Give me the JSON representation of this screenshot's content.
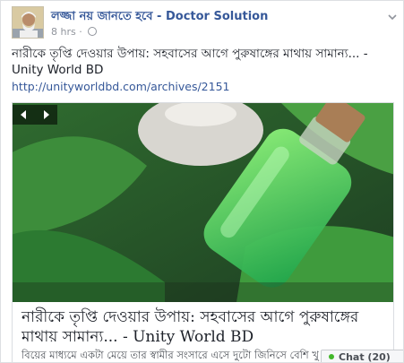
{
  "post": {
    "page_name": "লজ্জা নয় জানতে হবে - Doctor Solution",
    "time": "8 hrs",
    "text": "নারীকে তৃপ্তি দেওয়ার উপায়: সহবাসের আগে পুরুষাঙ্গের মাথায় সামান্য... - Unity World BD",
    "link": "http://unityworldbd.com/archives/2151"
  },
  "preview": {
    "title": "নারীকে তৃপ্তি দেওয়ার উপায়: সহবাসের আগে পুরুষাঙ্গের মাথায় সামান্য... - Unity World BD",
    "description": "বিয়ের মাধ্যমে একটা মেয়ে তার স্বামীর সংসারে এসে দুটো জিনিসে বেশি খু",
    "image_icon": "green-oil-bottle-with-leaves"
  },
  "icons": {
    "globe": "globe-icon",
    "chevron": "chevron-down-icon",
    "prev": "carousel-prev-icon",
    "next": "carousel-next-icon"
  },
  "chat": {
    "label": "Chat (20)",
    "status_color": "#42b72a"
  }
}
